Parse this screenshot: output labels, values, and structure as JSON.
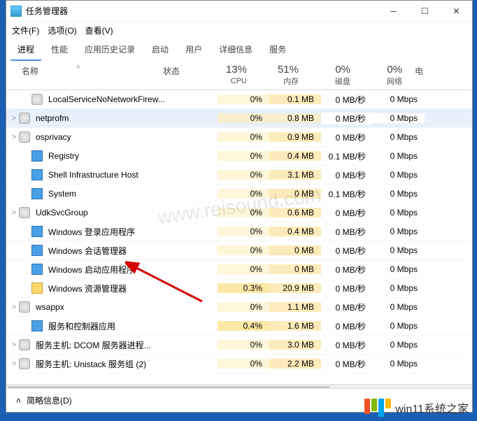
{
  "window": {
    "title": "任务管理器"
  },
  "menu": {
    "file": "文件(F)",
    "options": "选项(O)",
    "view": "查看(V)"
  },
  "tabs": {
    "processes": "进程",
    "performance": "性能",
    "app_history": "应用历史记录",
    "startup": "启动",
    "users": "用户",
    "details": "详细信息",
    "services": "服务"
  },
  "columns": {
    "name": "名称",
    "status": "状态",
    "cpu_pct": "13%",
    "cpu_lbl": "CPU",
    "mem_pct": "51%",
    "mem_lbl": "内存",
    "disk_pct": "0%",
    "disk_lbl": "磁盘",
    "net_pct": "0%",
    "net_lbl": "网络",
    "extra": "电"
  },
  "rows": [
    {
      "exp": "",
      "indent": true,
      "icon": "gear",
      "name": "LocalServiceNoNetworkFirew...",
      "cpu": "0%",
      "mem": "0.1 MB",
      "disk": "0 MB/秒",
      "net": "0 Mbps",
      "sel": false
    },
    {
      "exp": ">",
      "indent": false,
      "icon": "gear",
      "name": "netprofm",
      "cpu": "0%",
      "mem": "0.8 MB",
      "disk": "0 MB/秒",
      "net": "0 Mbps",
      "sel": true
    },
    {
      "exp": ">",
      "indent": false,
      "icon": "gear",
      "name": "osprivacy",
      "cpu": "0%",
      "mem": "0.9 MB",
      "disk": "0 MB/秒",
      "net": "0 Mbps",
      "sel": false
    },
    {
      "exp": "",
      "indent": true,
      "icon": "blue",
      "name": "Registry",
      "cpu": "0%",
      "mem": "0.4 MB",
      "disk": "0.1 MB/秒",
      "net": "0 Mbps",
      "sel": false
    },
    {
      "exp": "",
      "indent": true,
      "icon": "blue",
      "name": "Shell Infrastructure Host",
      "cpu": "0%",
      "mem": "3.1 MB",
      "disk": "0 MB/秒",
      "net": "0 Mbps",
      "sel": false
    },
    {
      "exp": "",
      "indent": true,
      "icon": "blue",
      "name": "System",
      "cpu": "0%",
      "mem": "0 MB",
      "disk": "0.1 MB/秒",
      "net": "0 Mbps",
      "sel": false
    },
    {
      "exp": ">",
      "indent": false,
      "icon": "gear",
      "name": "UdkSvcGroup",
      "cpu": "0%",
      "mem": "0.6 MB",
      "disk": "0 MB/秒",
      "net": "0 Mbps",
      "sel": false
    },
    {
      "exp": "",
      "indent": true,
      "icon": "blue",
      "name": "Windows 登录应用程序",
      "cpu": "0%",
      "mem": "0.4 MB",
      "disk": "0 MB/秒",
      "net": "0 Mbps",
      "sel": false
    },
    {
      "exp": "",
      "indent": true,
      "icon": "blue",
      "name": "Windows 会话管理器",
      "cpu": "0%",
      "mem": "0 MB",
      "disk": "0 MB/秒",
      "net": "0 Mbps",
      "sel": false
    },
    {
      "exp": "",
      "indent": true,
      "icon": "blue",
      "name": "Windows 启动应用程序",
      "cpu": "0%",
      "mem": "0 MB",
      "disk": "0 MB/秒",
      "net": "0 Mbps",
      "sel": false
    },
    {
      "exp": "",
      "indent": true,
      "icon": "folder",
      "name": "Windows 资源管理器",
      "cpu": "0.3%",
      "mem": "20.9 MB",
      "disk": "0 MB/秒",
      "net": "0 Mbps",
      "sel": false,
      "hi": true
    },
    {
      "exp": ">",
      "indent": false,
      "icon": "gear",
      "name": "wsappx",
      "cpu": "0%",
      "mem": "1.1 MB",
      "disk": "0 MB/秒",
      "net": "0 Mbps",
      "sel": false
    },
    {
      "exp": "",
      "indent": true,
      "icon": "blue",
      "name": "服务和控制器应用",
      "cpu": "0.4%",
      "mem": "1.6 MB",
      "disk": "0 MB/秒",
      "net": "0 Mbps",
      "sel": false,
      "hi": true
    },
    {
      "exp": ">",
      "indent": false,
      "icon": "gear",
      "name": "服务主机: DCOM 服务器进程...",
      "cpu": "0%",
      "mem": "3.0 MB",
      "disk": "0 MB/秒",
      "net": "0 Mbps",
      "sel": false
    },
    {
      "exp": ">",
      "indent": false,
      "icon": "gear",
      "name": "服务主机: Unistack 服务组 (2)",
      "cpu": "0%",
      "mem": "2.2 MB",
      "disk": "0 MB/秒",
      "net": "0 Mbps",
      "sel": false
    }
  ],
  "footer": {
    "label": "简略信息(D)"
  },
  "watermark": "www.reisound.com",
  "brand": "win11系统之家"
}
